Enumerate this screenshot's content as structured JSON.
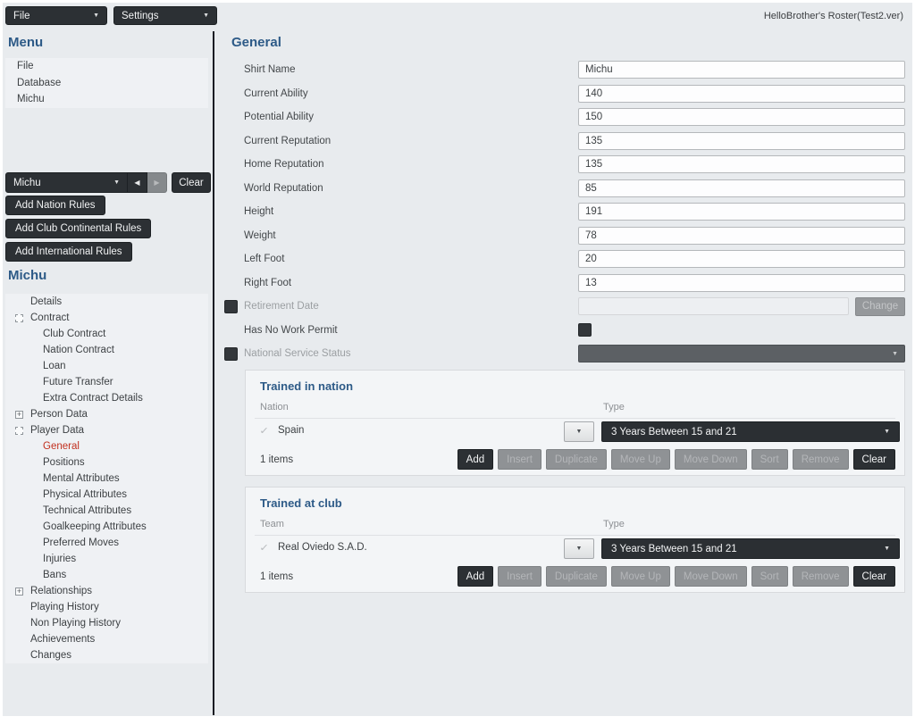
{
  "window": {
    "title": "HelloBrother's Roster(Test2.ver)"
  },
  "menubar": {
    "file_label": "File",
    "settings_label": "Settings"
  },
  "sidebar": {
    "menu_title": "Menu",
    "menu_items": [
      {
        "label": "File"
      },
      {
        "label": "Database"
      },
      {
        "label": "Michu"
      }
    ],
    "record_nav": {
      "selected": "Michu",
      "clear_label": "Clear"
    },
    "rule_buttons": [
      {
        "label": "Add Nation Rules"
      },
      {
        "label": "Add Club Continental Rules"
      },
      {
        "label": "Add International Rules"
      }
    ],
    "player_title": "Michu",
    "tree": [
      {
        "label": "Details",
        "level": 0,
        "icon": null
      },
      {
        "label": "Contract",
        "level": 0,
        "icon": "expanded"
      },
      {
        "label": "Club Contract",
        "level": 1,
        "icon": null
      },
      {
        "label": "Nation Contract",
        "level": 1,
        "icon": null
      },
      {
        "label": "Loan",
        "level": 1,
        "icon": null
      },
      {
        "label": "Future Transfer",
        "level": 1,
        "icon": null
      },
      {
        "label": "Extra Contract Details",
        "level": 1,
        "icon": null
      },
      {
        "label": "Person Data",
        "level": 0,
        "icon": "plus"
      },
      {
        "label": "Player Data",
        "level": 0,
        "icon": "expanded"
      },
      {
        "label": "General",
        "level": 1,
        "icon": null,
        "selected": true
      },
      {
        "label": "Positions",
        "level": 1,
        "icon": null
      },
      {
        "label": "Mental Attributes",
        "level": 1,
        "icon": null
      },
      {
        "label": "Physical Attributes",
        "level": 1,
        "icon": null
      },
      {
        "label": "Technical Attributes",
        "level": 1,
        "icon": null
      },
      {
        "label": "Goalkeeping Attributes",
        "level": 1,
        "icon": null
      },
      {
        "label": "Preferred Moves",
        "level": 1,
        "icon": null
      },
      {
        "label": "Injuries",
        "level": 1,
        "icon": null
      },
      {
        "label": "Bans",
        "level": 1,
        "icon": null
      },
      {
        "label": "Relationships",
        "level": 0,
        "icon": "plus"
      },
      {
        "label": "Playing History",
        "level": 0,
        "icon": null
      },
      {
        "label": "Non Playing History",
        "level": 0,
        "icon": null
      },
      {
        "label": "Achievements",
        "level": 0,
        "icon": null
      },
      {
        "label": "Changes",
        "level": 0,
        "icon": null
      }
    ]
  },
  "main": {
    "title": "General",
    "fields": [
      {
        "label": "Shirt Name",
        "value": "Michu"
      },
      {
        "label": "Current Ability",
        "value": "140"
      },
      {
        "label": "Potential Ability",
        "value": "150"
      },
      {
        "label": "Current Reputation",
        "value": "135"
      },
      {
        "label": "Home Reputation",
        "value": "135"
      },
      {
        "label": "World Reputation",
        "value": "85"
      },
      {
        "label": "Height",
        "value": "191"
      },
      {
        "label": "Weight",
        "value": "78"
      },
      {
        "label": "Left Foot",
        "value": "20"
      },
      {
        "label": "Right Foot",
        "value": "13"
      }
    ],
    "retirement": {
      "label": "Retirement Date",
      "value": "",
      "change_label": "Change"
    },
    "work_permit_label": "Has No Work Permit",
    "national_service_label": "National Service Status",
    "panels": [
      {
        "title": "Trained in nation",
        "col1": "Nation",
        "col2": "Type",
        "item": "Spain",
        "type_value": "3 Years Between 15 and 21",
        "count": "1 items",
        "buttons": [
          {
            "label": "Add",
            "enabled": true
          },
          {
            "label": "Insert",
            "enabled": false
          },
          {
            "label": "Duplicate",
            "enabled": false
          },
          {
            "label": "Move Up",
            "enabled": false
          },
          {
            "label": "Move Down",
            "enabled": false
          },
          {
            "label": "Sort",
            "enabled": false
          },
          {
            "label": "Remove",
            "enabled": false
          },
          {
            "label": "Clear",
            "enabled": true
          }
        ]
      },
      {
        "title": "Trained at club",
        "col1": "Team",
        "col2": "Type",
        "item": "Real Oviedo S.A.D.",
        "type_value": "3 Years Between 15 and 21",
        "count": "1 items",
        "buttons": [
          {
            "label": "Add",
            "enabled": true
          },
          {
            "label": "Insert",
            "enabled": false
          },
          {
            "label": "Duplicate",
            "enabled": false
          },
          {
            "label": "Move Up",
            "enabled": false
          },
          {
            "label": "Move Down",
            "enabled": false
          },
          {
            "label": "Sort",
            "enabled": false
          },
          {
            "label": "Remove",
            "enabled": false
          },
          {
            "label": "Clear",
            "enabled": true
          }
        ]
      }
    ]
  },
  "colors": {
    "accent": "#2d5a87",
    "dark": "#2c3034",
    "red": "#c2301f"
  }
}
